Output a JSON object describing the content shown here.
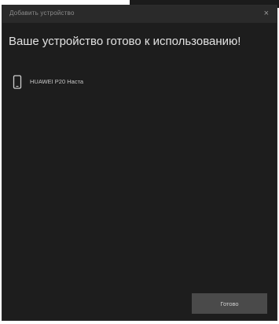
{
  "window": {
    "title": "Добавить устройство",
    "close_icon": "close-icon",
    "close_glyph": "×"
  },
  "main": {
    "headline": "Ваше устройство готово к использованию!",
    "device": {
      "icon": "phone-icon",
      "name": "HUAWEI P20 Наста"
    }
  },
  "footer": {
    "done_label": "Готово"
  },
  "colors": {
    "dialog_background": "#1d1d1d",
    "titlebar_background": "#2a2a2a",
    "button_background": "#4a4a4a",
    "text_primary": "#e2e2e2"
  }
}
